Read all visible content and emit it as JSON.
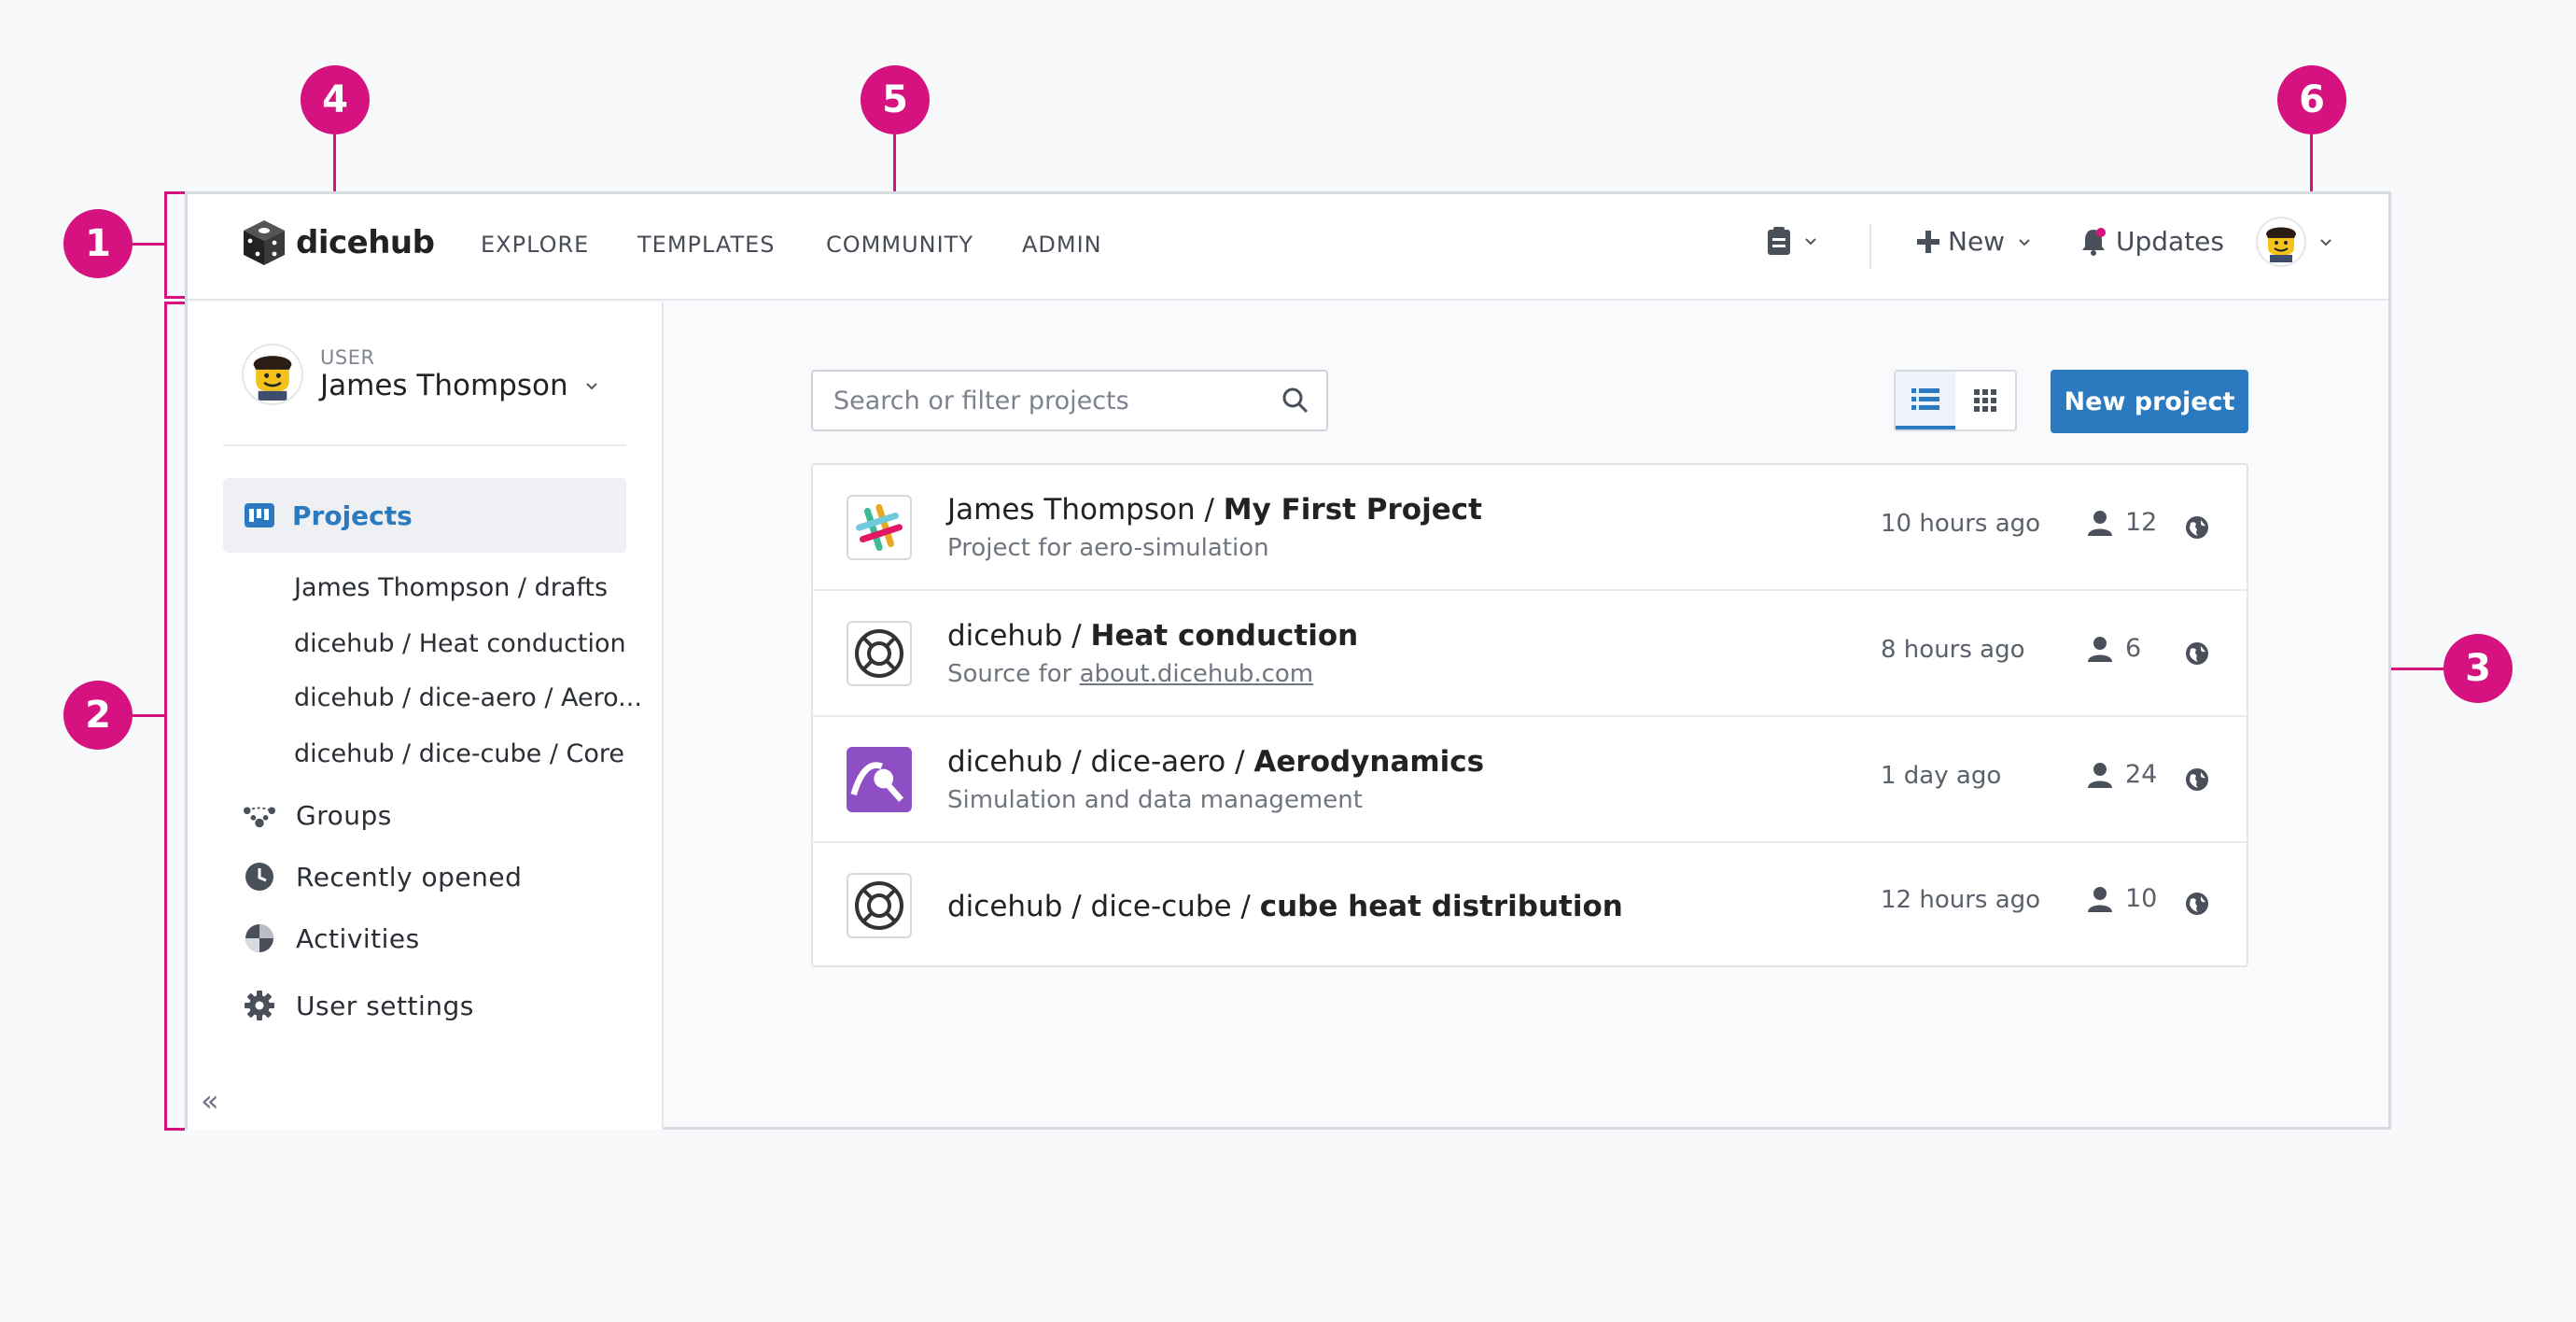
{
  "callouts": [
    "1",
    "2",
    "3",
    "4",
    "5",
    "6"
  ],
  "header": {
    "logo_text": "dicehub",
    "nav": [
      "EXPLORE",
      "TEMPLATES",
      "COMMUNITY",
      "ADMIN"
    ],
    "new_label": "New",
    "updates_label": "Updates"
  },
  "sidebar": {
    "user_role": "USER",
    "user_name": "James Thompson",
    "projects_label": "Projects",
    "sub_items": [
      "James Thompson / drafts",
      "dicehub / Heat conduction",
      "dicehub / dice-aero / Aero...",
      "dicehub / dice-cube / Core"
    ],
    "items": [
      {
        "label": "Groups",
        "icon": "groups-icon"
      },
      {
        "label": "Recently opened",
        "icon": "clock-icon"
      },
      {
        "label": "Activities",
        "icon": "activities-icon"
      },
      {
        "label": "User settings",
        "icon": "gear-icon"
      }
    ],
    "collapse_glyph": "«"
  },
  "main": {
    "search_placeholder": "Search or filter projects",
    "new_project_label": "New project",
    "projects": [
      {
        "owner": "James Thompson / ",
        "name": "My First Project",
        "desc": "Project for aero-simulation",
        "desc_link": "",
        "time": "10 hours ago",
        "users": "12",
        "icon": "slack-style-icon"
      },
      {
        "owner": "dicehub / ",
        "name": "Heat conduction",
        "desc": "Source for ",
        "desc_link": "about.dicehub.com",
        "time": "8 hours ago",
        "users": "6",
        "icon": "lifebuoy-icon"
      },
      {
        "owner": "dicehub / dice-aero / ",
        "name": "Aerodynamics",
        "desc": "Simulation and data management",
        "desc_link": "",
        "time": "1 day ago",
        "users": "24",
        "icon": "aero-icon"
      },
      {
        "owner": "dicehub / dice-cube / ",
        "name": "cube heat distribution",
        "desc": "",
        "desc_link": "",
        "time": "12 hours ago",
        "users": "10",
        "icon": "lifebuoy-icon"
      }
    ]
  },
  "colors": {
    "accent": "#2b7abf",
    "callout": "#d5127f",
    "aero": "#8e4fc4"
  }
}
